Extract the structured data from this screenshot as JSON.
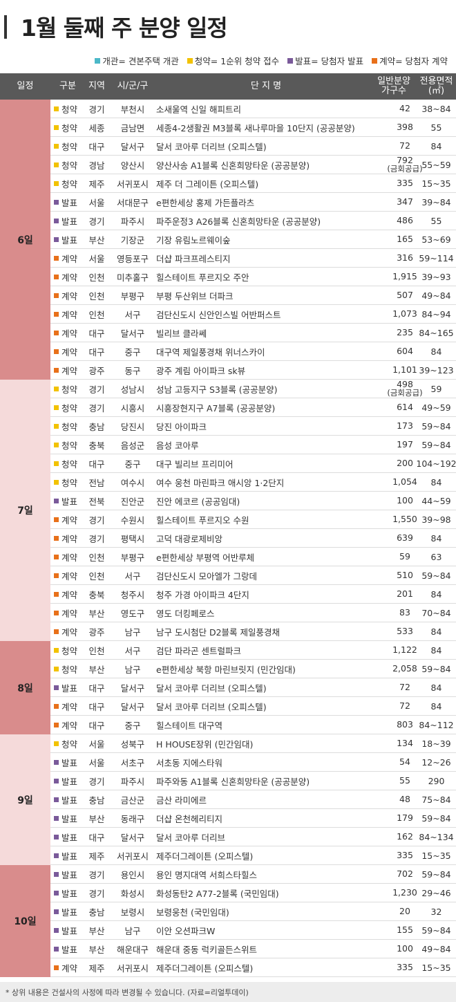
{
  "title": "1월 둘째 주 분양 일정",
  "legend": [
    {
      "label": "개관= 견본주택 개관",
      "color": "#4bb8c8"
    },
    {
      "label": "청약= 1순위 청약 접수",
      "color": "#f2c200"
    },
    {
      "label": "발표= 당첨자 발표",
      "color": "#7a5a9a"
    },
    {
      "label": "계약= 당첨자 계약",
      "color": "#e8701a"
    }
  ],
  "headers": {
    "date": "일정",
    "type": "구분",
    "region": "지역",
    "city": "시/군/구",
    "name": "단 지 명",
    "units_1": "일반분양",
    "units_2": "가구수",
    "area_1": "전용면적",
    "area_2": "(㎡)"
  },
  "type_colors": {
    "청약": "#f2c200",
    "발표": "#7a5a9a",
    "계약": "#e8701a"
  },
  "days": [
    {
      "label": "6일",
      "color": "#d98c8c",
      "rows": [
        {
          "type": "청약",
          "region": "경기",
          "city": "부천시",
          "name": "소새울역 신일 해피트리",
          "units": "42",
          "area": "38~84"
        },
        {
          "type": "청약",
          "region": "세종",
          "city": "금남면",
          "name": "세종4-2생활권 M3블록 새나루마을 10단지 (공공분양)",
          "units": "398",
          "area": "55"
        },
        {
          "type": "청약",
          "region": "대구",
          "city": "달서구",
          "name": "달서 코아루 더리브 (오피스텔)",
          "units": "72",
          "area": "84"
        },
        {
          "type": "청약",
          "region": "경남",
          "city": "양산시",
          "name": "양산사송 A1블록 신혼희망타운 (공공분양)",
          "units": "792",
          "units_sub": "(금회공급)",
          "area": "55~59"
        },
        {
          "type": "청약",
          "region": "제주",
          "city": "서귀포시",
          "name": "제주 더 그레이튼 (오피스텔)",
          "units": "335",
          "area": "15~35"
        },
        {
          "type": "발표",
          "region": "서울",
          "city": "서대문구",
          "name": "e편한세상 홍제 가든플라츠",
          "units": "347",
          "area": "39~84"
        },
        {
          "type": "발표",
          "region": "경기",
          "city": "파주시",
          "name": "파주운정3 A26블록 신혼희망타운 (공공분양)",
          "units": "486",
          "area": "55"
        },
        {
          "type": "발표",
          "region": "부산",
          "city": "기장군",
          "name": "기장 유림노르웨이숲",
          "units": "165",
          "area": "53~69"
        },
        {
          "type": "계약",
          "region": "서울",
          "city": "영등포구",
          "name": "더샵 파크프레스티지",
          "units": "316",
          "area": "59~114"
        },
        {
          "type": "계약",
          "region": "인천",
          "city": "미추홀구",
          "name": "힐스테이트 푸르지오 주안",
          "units": "1,915",
          "area": "39~93"
        },
        {
          "type": "계약",
          "region": "인천",
          "city": "부평구",
          "name": "부평 두산위브 더파크",
          "units": "507",
          "area": "49~84"
        },
        {
          "type": "계약",
          "region": "인천",
          "city": "서구",
          "name": "검단신도시 신안인스빌 어반퍼스트",
          "units": "1,073",
          "area": "84~94"
        },
        {
          "type": "계약",
          "region": "대구",
          "city": "달서구",
          "name": "빌리브 클라쎄",
          "units": "235",
          "area": "84~165"
        },
        {
          "type": "계약",
          "region": "대구",
          "city": "중구",
          "name": "대구역 제일풍경채 위너스카이",
          "units": "604",
          "area": "84"
        },
        {
          "type": "계약",
          "region": "광주",
          "city": "동구",
          "name": "광주 계림 아이파크 sk뷰",
          "units": "1,101",
          "area": "39~123"
        }
      ]
    },
    {
      "label": "7일",
      "color": "#f5dada",
      "rows": [
        {
          "type": "청약",
          "region": "경기",
          "city": "성남시",
          "name": "성남 고등지구 S3블록 (공공분양)",
          "units": "498",
          "units_sub": "(금회공급)",
          "area": "59"
        },
        {
          "type": "청약",
          "region": "경기",
          "city": "시흥시",
          "name": "시흥장현지구 A7블록 (공공분양)",
          "units": "614",
          "area": "49~59"
        },
        {
          "type": "청약",
          "region": "충남",
          "city": "당진시",
          "name": "당진 아이파크",
          "units": "173",
          "area": "59~84"
        },
        {
          "type": "청약",
          "region": "충북",
          "city": "음성군",
          "name": "음성 코아루",
          "units": "197",
          "area": "59~84"
        },
        {
          "type": "청약",
          "region": "대구",
          "city": "중구",
          "name": "대구 빌리브 프리미어",
          "units": "200",
          "area": "104~192"
        },
        {
          "type": "청약",
          "region": "전남",
          "city": "여수시",
          "name": "여수 웅천 마린파크 애시앙 1·2단지",
          "units": "1,054",
          "area": "84"
        },
        {
          "type": "발표",
          "region": "전북",
          "city": "진안군",
          "name": "진안 에코르 (공공임대)",
          "units": "100",
          "area": "44~59"
        },
        {
          "type": "계약",
          "region": "경기",
          "city": "수원시",
          "name": "힐스테이트 푸르지오 수원",
          "units": "1,550",
          "area": "39~98"
        },
        {
          "type": "계약",
          "region": "경기",
          "city": "평택시",
          "name": "고덕 대광로제비앙",
          "units": "639",
          "area": "84"
        },
        {
          "type": "계약",
          "region": "인천",
          "city": "부평구",
          "name": "e편한세상 부평역 어반루체",
          "units": "59",
          "area": "63"
        },
        {
          "type": "계약",
          "region": "인천",
          "city": "서구",
          "name": "검단신도시 모아엘가 그랑데",
          "units": "510",
          "area": "59~84"
        },
        {
          "type": "계약",
          "region": "충북",
          "city": "청주시",
          "name": "청주 가경 아이파크 4단지",
          "units": "201",
          "area": "84"
        },
        {
          "type": "계약",
          "region": "부산",
          "city": "영도구",
          "name": "영도 더킹페로스",
          "units": "83",
          "area": "70~84"
        },
        {
          "type": "계약",
          "region": "광주",
          "city": "남구",
          "name": "남구 도시첨단 D2블록 제일풍경채",
          "units": "533",
          "area": "84"
        }
      ]
    },
    {
      "label": "8일",
      "color": "#d98c8c",
      "rows": [
        {
          "type": "청약",
          "region": "인천",
          "city": "서구",
          "name": "검단 파라곤 센트럴파크",
          "units": "1,122",
          "area": "84"
        },
        {
          "type": "청약",
          "region": "부산",
          "city": "남구",
          "name": "e편한세상 북항 마린브릿지 (민간임대)",
          "units": "2,058",
          "area": "59~84"
        },
        {
          "type": "발표",
          "region": "대구",
          "city": "달서구",
          "name": "달서 코아루 더리브 (오피스텔)",
          "units": "72",
          "area": "84"
        },
        {
          "type": "계약",
          "region": "대구",
          "city": "달서구",
          "name": "달서 코아루 더리브 (오피스텔)",
          "units": "72",
          "area": "84"
        },
        {
          "type": "계약",
          "region": "대구",
          "city": "중구",
          "name": "힐스테이트 대구역",
          "units": "803",
          "area": "84~112"
        }
      ]
    },
    {
      "label": "9일",
      "color": "#f5dada",
      "rows": [
        {
          "type": "청약",
          "region": "서울",
          "city": "성북구",
          "name": "H HOUSE장위 (민간임대)",
          "units": "134",
          "area": "18~39"
        },
        {
          "type": "발표",
          "region": "서울",
          "city": "서초구",
          "name": "서초동 지에스타워",
          "units": "54",
          "area": "12~26"
        },
        {
          "type": "발표",
          "region": "경기",
          "city": "파주시",
          "name": "파주와동 A1블록 신혼희망타운 (공공분양)",
          "units": "55",
          "area": "290"
        },
        {
          "type": "발표",
          "region": "충남",
          "city": "금산군",
          "name": "금산 라미에르",
          "units": "48",
          "area": "75~84"
        },
        {
          "type": "발표",
          "region": "부산",
          "city": "동래구",
          "name": "더샵 온천헤리티지",
          "units": "179",
          "area": "59~84"
        },
        {
          "type": "발표",
          "region": "대구",
          "city": "달서구",
          "name": "달서 코아루 더리브",
          "units": "162",
          "area": "84~134"
        },
        {
          "type": "발표",
          "region": "제주",
          "city": "서귀포시",
          "name": "제주더그레이튼 (오피스텔)",
          "units": "335",
          "area": "15~35"
        }
      ]
    },
    {
      "label": "10일",
      "color": "#d98c8c",
      "rows": [
        {
          "type": "발표",
          "region": "경기",
          "city": "용인시",
          "name": "용인 명지대역 서희스타힐스",
          "units": "702",
          "area": "59~84"
        },
        {
          "type": "발표",
          "region": "경기",
          "city": "화성시",
          "name": "화성동탄2 A77-2블록 (국민임대)",
          "units": "1,230",
          "area": "29~46"
        },
        {
          "type": "발표",
          "region": "충남",
          "city": "보령시",
          "name": "보령웅천 (국민임대)",
          "units": "20",
          "area": "32"
        },
        {
          "type": "발표",
          "region": "부산",
          "city": "남구",
          "name": "이안 오션파크W",
          "units": "155",
          "area": "59~84"
        },
        {
          "type": "발표",
          "region": "부산",
          "city": "해운대구",
          "name": "해운대 중동 럭키골든스위트",
          "units": "100",
          "area": "49~84"
        },
        {
          "type": "계약",
          "region": "제주",
          "city": "서귀포시",
          "name": "제주더그레이튼 (오피스텔)",
          "units": "335",
          "area": "15~35"
        }
      ]
    }
  ],
  "footnote": "* 상위 내용은 건설사의 사정에 따라 변경될 수 있습니다. (자료=리얼투데이)"
}
